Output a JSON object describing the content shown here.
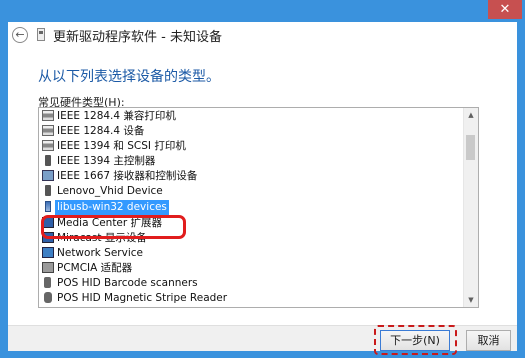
{
  "window": {
    "close_label": "✕"
  },
  "wizard": {
    "back_label": "←",
    "title": "更新驱动程序软件 - 未知设备",
    "heading": "从以下列表选择设备的类型。",
    "list_label": "常见硬件类型(H):",
    "items": [
      {
        "label": "IEEE 1284.4 兼容打印机",
        "icon": "printer-icon"
      },
      {
        "label": "IEEE 1284.4 设备",
        "icon": "printer-icon"
      },
      {
        "label": "IEEE 1394 和 SCSI 打印机",
        "icon": "printer-icon"
      },
      {
        "label": "IEEE 1394 主控制器",
        "icon": "plug-icon"
      },
      {
        "label": "IEEE 1667 接收器和控制设备",
        "icon": "card-icon"
      },
      {
        "label": "Lenovo_Vhid Device",
        "icon": "plug-icon"
      },
      {
        "label": "libusb-win32 devices",
        "icon": "usb-plug-icon",
        "selected": true
      },
      {
        "label": "Media Center 扩展器",
        "icon": "monitor-icon"
      },
      {
        "label": "Miracast 显示设备",
        "icon": "monitor-icon"
      },
      {
        "label": "Network Service",
        "icon": "network-icon"
      },
      {
        "label": "PCMCIA 适配器",
        "icon": "pcmcia-icon"
      },
      {
        "label": "POS HID Barcode scanners",
        "icon": "plug-icon"
      },
      {
        "label": "POS HID Magnetic Stripe Reader",
        "icon": "hid-icon"
      }
    ],
    "scroll_up": "▲",
    "scroll_down": "▼",
    "next_label": "下一步(N)",
    "cancel_label": "取消"
  },
  "colors": {
    "frame": "#3a92dd",
    "heading": "#1c5aa6",
    "selection": "#3399ff",
    "annotation": "#e11d1d"
  }
}
